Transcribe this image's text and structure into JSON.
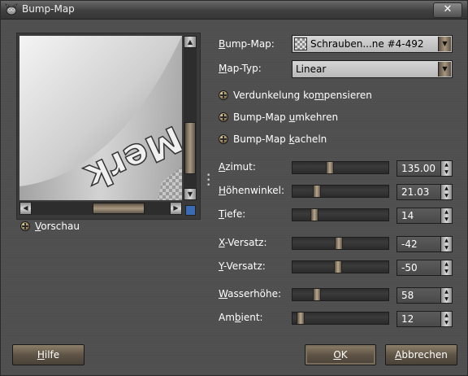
{
  "window": {
    "title": "Bump-Map",
    "close_glyph": "✕"
  },
  "preview": {
    "toggle_label_prefix": "",
    "toggle_label": "Vorschau",
    "toggle_label_ul": "V",
    "toggle_label_rest": "orschau"
  },
  "form": {
    "bumpmap": {
      "label_ul": "B",
      "label_rest": "ump-Map:",
      "value": "Schrauben...ne #4-492"
    },
    "maptype": {
      "label_pre": "",
      "label_ul": "M",
      "label_rest": "ap-Typ:",
      "value": "Linear"
    },
    "compensate": {
      "pre": "Verdunkelung ko",
      "ul": "m",
      "post": "pensieren"
    },
    "invert": {
      "pre": "Bump-Map ",
      "ul": "u",
      "post": "mkehren"
    },
    "tile": {
      "pre": "Bump-Map ",
      "ul": "k",
      "post": "acheln"
    }
  },
  "sliders": [
    {
      "pre": "",
      "ul": "A",
      "post": "zimut:",
      "value": "135.00",
      "fraction": 0.375
    },
    {
      "pre": "",
      "ul": "H",
      "post": "öhenwinkel:",
      "value": "21.03",
      "fraction": 0.233
    },
    {
      "pre": "",
      "ul": "T",
      "post": "iefe:",
      "value": "14",
      "fraction": 0.2
    },
    {
      "pre": "",
      "ul": "X",
      "post": "-Versatz:",
      "value": "-42",
      "fraction": 0.48
    },
    {
      "pre": "",
      "ul": "Y",
      "post": "-Versatz:",
      "value": "-50",
      "fraction": 0.47
    },
    {
      "pre": "",
      "ul": "W",
      "post": "asserhöhe:",
      "value": "58",
      "fraction": 0.227
    },
    {
      "pre": "Am",
      "ul": "b",
      "post": "ient:",
      "value": "12",
      "fraction": 0.047
    }
  ],
  "buttons": {
    "help": {
      "ul": "H",
      "rest": "ilfe"
    },
    "ok": {
      "ul": "O",
      "rest": "K"
    },
    "cancel": {
      "ul": "A",
      "rest": "bbrechen"
    }
  },
  "icons": {
    "app": "gimp-icon",
    "arrow_up": "▲",
    "arrow_down": "▼",
    "arrow_left": "◀",
    "arrow_right": "▶"
  },
  "colors": {
    "accent": "#3b6bb5",
    "preview_text": "#ffffff"
  },
  "preview_text": "Merk"
}
